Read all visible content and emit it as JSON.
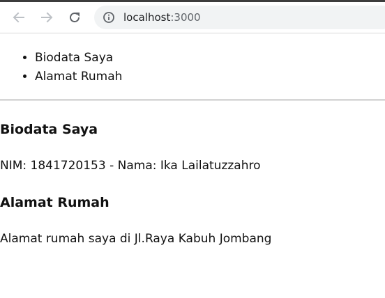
{
  "browser": {
    "address": {
      "host": "localhost",
      "port": ":3000"
    },
    "icons": {
      "back": "arrow-left-icon",
      "forward": "arrow-right-icon",
      "reload": "reload-icon",
      "site_info": "info-icon"
    },
    "colors": {
      "omnibox_bg": "#f1f3f4",
      "nav_disabled": "#bdc1c6",
      "nav_active": "#5f6368"
    }
  },
  "page": {
    "nav_links": [
      {
        "label": "Biodata Saya"
      },
      {
        "label": "Alamat Rumah"
      }
    ],
    "sections": [
      {
        "heading": "Biodata Saya",
        "text": "NIM: 1841720153 - Nama: Ika Lailatuzzahro"
      },
      {
        "heading": "Alamat Rumah",
        "text": "Alamat rumah saya di Jl.Raya Kabuh Jombang"
      }
    ]
  }
}
